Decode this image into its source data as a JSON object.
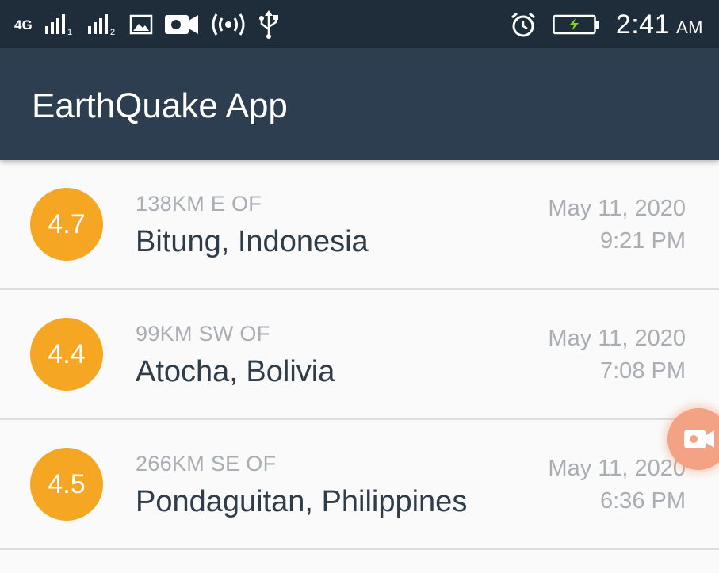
{
  "status_bar": {
    "network_label": "4G",
    "sim1_index": "1",
    "sim2_index": "2",
    "time": "2:41",
    "ampm": "AM",
    "icons": [
      "network-4g-icon",
      "signal-sim1-icon",
      "signal-sim2-icon",
      "gallery-icon",
      "video-camera-icon",
      "hotspot-icon",
      "usb-icon",
      "alarm-icon",
      "battery-charging-icon"
    ]
  },
  "app_bar": {
    "title": "EarthQuake App"
  },
  "quakes": [
    {
      "magnitude": "4.7",
      "offset": "138KM E OF",
      "location": "Bitung, Indonesia",
      "date": "May 11, 2020",
      "time": "9:21 PM"
    },
    {
      "magnitude": "4.4",
      "offset": "99KM SW OF",
      "location": "Atocha, Bolivia",
      "date": "May 11, 2020",
      "time": "7:08 PM"
    },
    {
      "magnitude": "4.5",
      "offset": "266KM SE OF",
      "location": "Pondaguitan, Philippines",
      "date": "May 11, 2020",
      "time": "6:36 PM"
    }
  ],
  "colors": {
    "status_bar": "#1f2d3a",
    "app_bar": "#2c3e4f",
    "magnitude_circle": "#f5a623",
    "primary_text": "#2f3d4a",
    "secondary_text": "#a9aeb3",
    "background": "#fafafa",
    "floating_bubble": "#f3a283",
    "battery_bolt": "#7ed321"
  },
  "floating_bubble": {
    "icon": "video-camera-icon"
  }
}
